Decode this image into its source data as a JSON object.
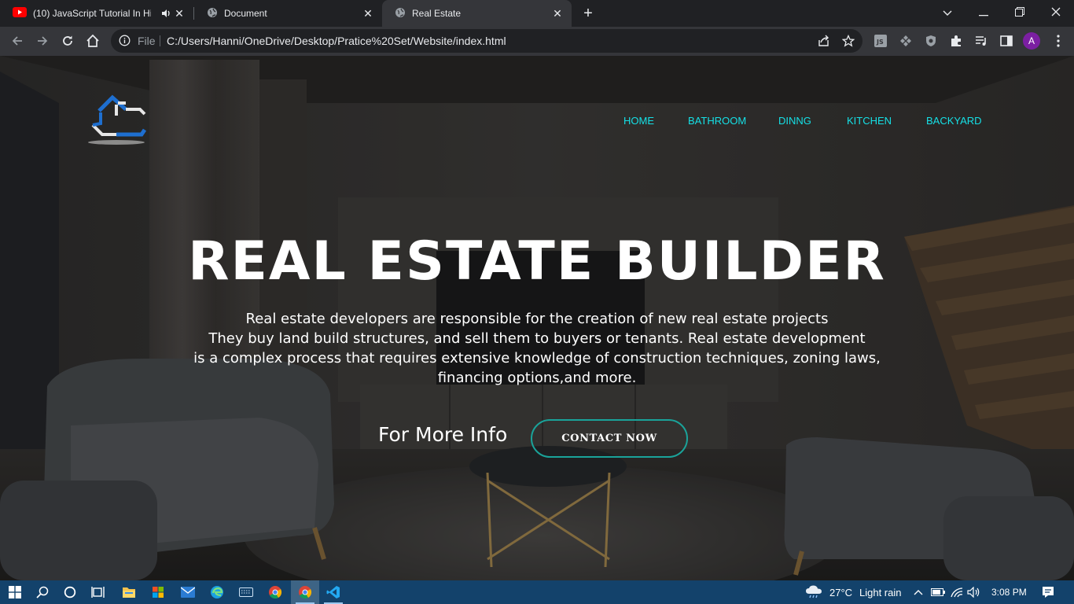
{
  "browser": {
    "tabs": [
      {
        "title": "(10) JavaScript Tutorial In Hin",
        "active": false,
        "audio": true,
        "icon": "youtube-icon"
      },
      {
        "title": "Document",
        "active": false,
        "audio": false,
        "icon": "globe-icon"
      },
      {
        "title": "Real Estate",
        "active": true,
        "audio": false,
        "icon": "globe-icon"
      }
    ],
    "address": {
      "scheme_label": "File",
      "url": "C:/Users/Hanni/OneDrive/Desktop/Pratice%20Set/Website/index.html"
    },
    "profile_initial": "A"
  },
  "page": {
    "nav": [
      "HOME",
      "BATHROOM",
      "DINNG",
      "KITCHEN",
      "BACKYARD"
    ],
    "hero": {
      "title": "REAL ESTATE BUILDER",
      "lines": [
        "Real estate developers are responsible for the creation of new real estate projects",
        "They buy land build structures, and sell them to buyers or tenants. Real estate development",
        "is a complex process that requires extensive knowledge of construction techniques, zoning laws,",
        "financing options,and more."
      ],
      "more_info": "For More Info",
      "cta": "CONTACT NOW"
    },
    "colors": {
      "nav": "#15e0e6",
      "cta_border": "#1aa39a",
      "logo_blue": "#1e6fd0"
    }
  },
  "taskbar": {
    "weather_temp": "27°C",
    "weather_desc": "Light rain",
    "time": "3:08 PM"
  }
}
